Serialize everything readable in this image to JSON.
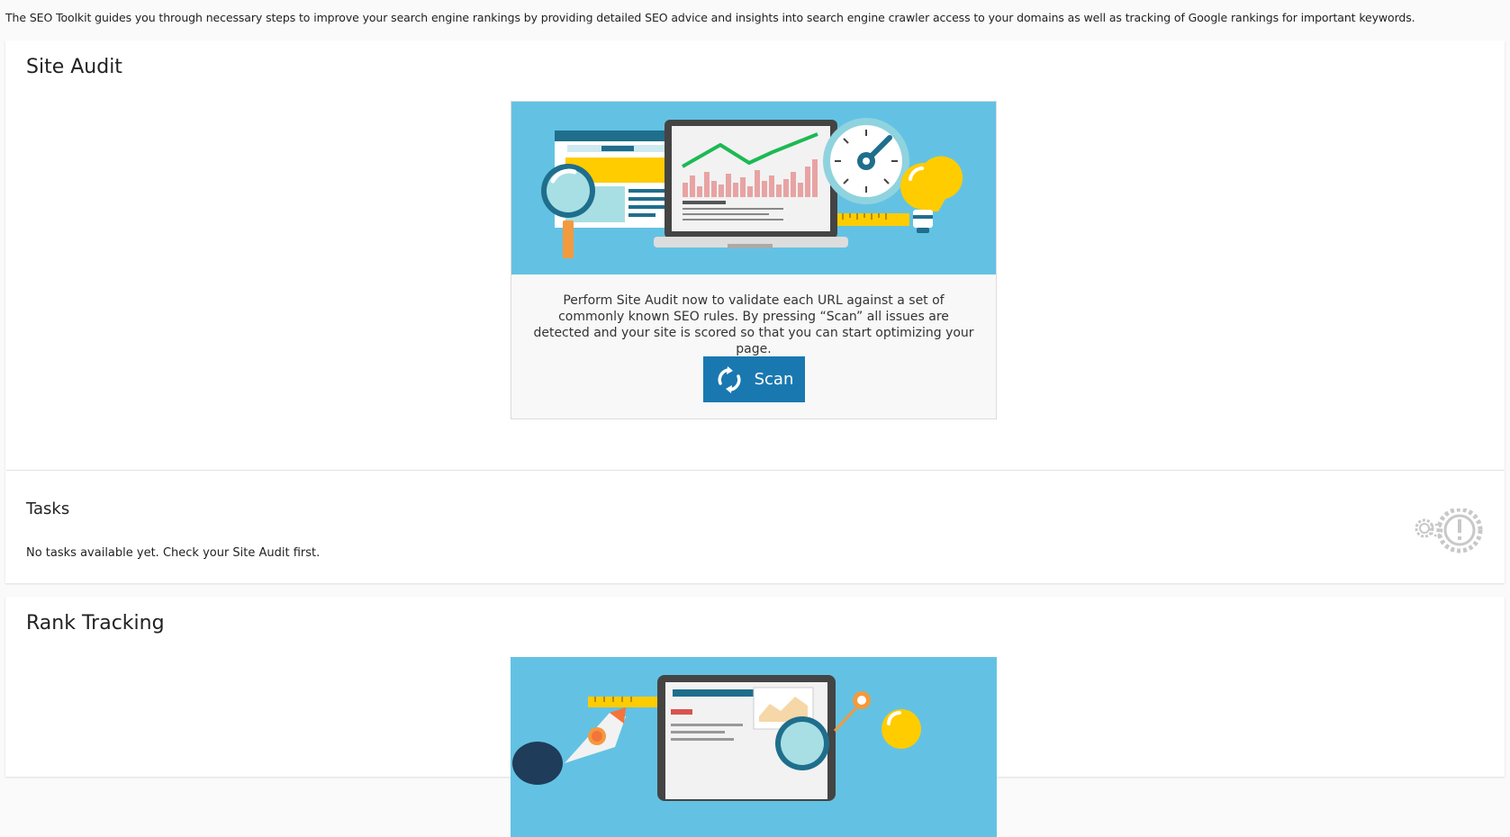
{
  "intro": "The SEO Toolkit guides you through necessary steps to improve your search engine rankings by providing detailed SEO advice and insights into search engine crawler access to your domains as well as tracking of Google rankings for important keywords.",
  "site_audit": {
    "title": "Site Audit",
    "description": "Perform Site Audit now to validate each URL against a set of commonly known SEO rules. By pressing “Scan” all issues are detected and your site is scored so that you can start optimizing your page.",
    "scan_label": "Scan",
    "illustration_icon": "seo-audit-illustration"
  },
  "tasks": {
    "title": "Tasks",
    "empty_message": "No tasks available yet. Check your Site Audit first.",
    "icon": "gears-warning-icon"
  },
  "rank_tracking": {
    "title": "Rank Tracking",
    "illustration_icon": "rank-tracking-illustration"
  },
  "colors": {
    "accent": "#1a78b0",
    "illustration_bg": "#63c2e3",
    "chart_green": "#1db954",
    "bar_pink": "#e8a3a3",
    "bulb_yellow": "#ffcc00"
  }
}
